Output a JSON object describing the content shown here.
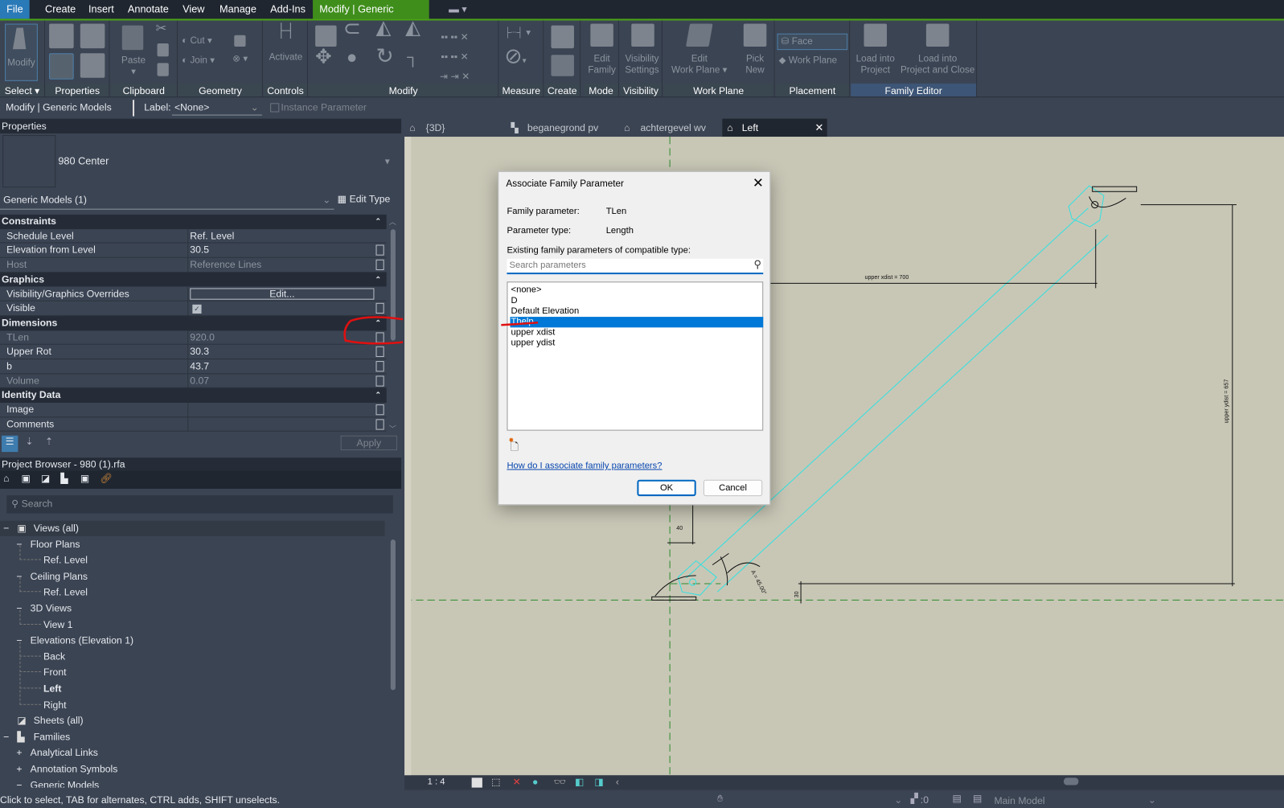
{
  "menu": {
    "tabs": [
      "File",
      "Create",
      "Insert",
      "Annotate",
      "View",
      "Manage",
      "Add-Ins",
      "Modify | Generic Models"
    ]
  },
  "ribbon": {
    "panels": [
      "Select",
      "Properties",
      "Clipboard",
      "Geometry",
      "Controls",
      "Modify",
      "Measure",
      "Create",
      "Mode",
      "Visibility",
      "Work Plane",
      "Placement",
      "Family Editor"
    ],
    "modify": "Modify",
    "paste": "Paste",
    "cut": "Cut",
    "join": "Join",
    "activate": "Activate",
    "edit_family": [
      "Edit",
      "Family"
    ],
    "visibility_settings": [
      "Visibility",
      "Settings"
    ],
    "edit_work_plane": [
      "Edit",
      "Work Plane"
    ],
    "pick_new": [
      "Pick",
      "New"
    ],
    "face": "Face",
    "work_plane": "Work Plane",
    "load_into_project": [
      "Load into",
      "Project"
    ],
    "load_into_project_close": [
      "Load into",
      "Project and Close"
    ]
  },
  "options_bar": {
    "context": "Modify | Generic Models",
    "label_caption": "Label:",
    "label_value": "<None>",
    "instance_parameter": "Instance Parameter"
  },
  "properties": {
    "title": "Properties",
    "type_name": "980 Center",
    "category": "Generic Models (1)",
    "edit_type": "Edit Type",
    "apply": "Apply",
    "sections": [
      {
        "name": "Constraints",
        "rows": [
          {
            "label": "Schedule Level",
            "value": "Ref. Level"
          },
          {
            "label": "Elevation from Level",
            "value": "30.5"
          },
          {
            "label": "Host",
            "value": "Reference Lines",
            "disabled": true
          }
        ]
      },
      {
        "name": "Graphics",
        "rows": [
          {
            "label": "Visibility/Graphics Overrides",
            "value": "Edit...",
            "button": true
          },
          {
            "label": "Visible",
            "value": "",
            "checked": true
          }
        ]
      },
      {
        "name": "Dimensions",
        "rows": [
          {
            "label": "TLen",
            "value": "920.0",
            "disabled": true
          },
          {
            "label": "Upper Rot",
            "value": "30.3"
          },
          {
            "label": "b",
            "value": "43.7"
          },
          {
            "label": "Volume",
            "value": "0.07",
            "disabled": true
          }
        ]
      },
      {
        "name": "Identity Data",
        "rows": [
          {
            "label": "Image",
            "value": ""
          },
          {
            "label": "Comments",
            "value": ""
          }
        ]
      }
    ]
  },
  "browser": {
    "title": "Project Browser - 980 (1).rfa",
    "search_placeholder": "Search",
    "items": [
      {
        "label": "Views (all)",
        "level": 0,
        "toggle": "−",
        "icon": "views"
      },
      {
        "label": "Floor Plans",
        "level": 1,
        "toggle": "−"
      },
      {
        "label": "Ref. Level",
        "level": 2
      },
      {
        "label": "Ceiling Plans",
        "level": 1,
        "toggle": "−"
      },
      {
        "label": "Ref. Level",
        "level": 2
      },
      {
        "label": "3D Views",
        "level": 1,
        "toggle": "−"
      },
      {
        "label": "View 1",
        "level": 2
      },
      {
        "label": "Elevations (Elevation 1)",
        "level": 1,
        "toggle": "−"
      },
      {
        "label": "Back",
        "level": 2
      },
      {
        "label": "Front",
        "level": 2
      },
      {
        "label": "Left",
        "level": 2,
        "bold": true
      },
      {
        "label": "Right",
        "level": 2
      },
      {
        "label": "Sheets (all)",
        "level": 0,
        "icon": "sheets"
      },
      {
        "label": "Families",
        "level": 0,
        "toggle": "−",
        "icon": "families"
      },
      {
        "label": "Analytical Links",
        "level": 1,
        "toggle": "+"
      },
      {
        "label": "Annotation Symbols",
        "level": 1,
        "toggle": "+"
      },
      {
        "label": "Generic Models",
        "level": 1,
        "toggle": "−"
      }
    ]
  },
  "view_tabs": [
    {
      "label": "{3D}"
    },
    {
      "label": "beganegrond pv"
    },
    {
      "label": "achtergevel wv"
    },
    {
      "label": "Left",
      "active": true
    }
  ],
  "drawing": {
    "upper_xdist": "upper xdist = 700",
    "upper_ydist": "upper ydist = 657",
    "dim_40": "40",
    "dim_30": "30",
    "angle": "A = 45.00°"
  },
  "dialog": {
    "title": "Associate Family Parameter",
    "family_parameter_label": "Family parameter:",
    "family_parameter": "TLen",
    "parameter_type_label": "Parameter type:",
    "parameter_type": "Length",
    "existing_label": "Existing family parameters of compatible type:",
    "search_placeholder": "Search parameters",
    "options": [
      "<none>",
      "D",
      "Default Elevation",
      "Thelp",
      "upper xdist",
      "upper ydist"
    ],
    "selected": "Thelp",
    "help_link": "How do I associate family parameters?",
    "ok": "OK",
    "cancel": "Cancel"
  },
  "view_control": {
    "scale": "1 : 4"
  },
  "status": {
    "message": "Click to select, TAB for alternates, CTRL adds, SHIFT unselects.",
    "selection_count": ":0",
    "model": "Main Model"
  },
  "colors": {
    "accent": "#0078d7",
    "context_tab": "#3f8e1c",
    "canvas": "#c8c7b6",
    "annotation": "#e01010",
    "cyan": "#33e0e0"
  }
}
